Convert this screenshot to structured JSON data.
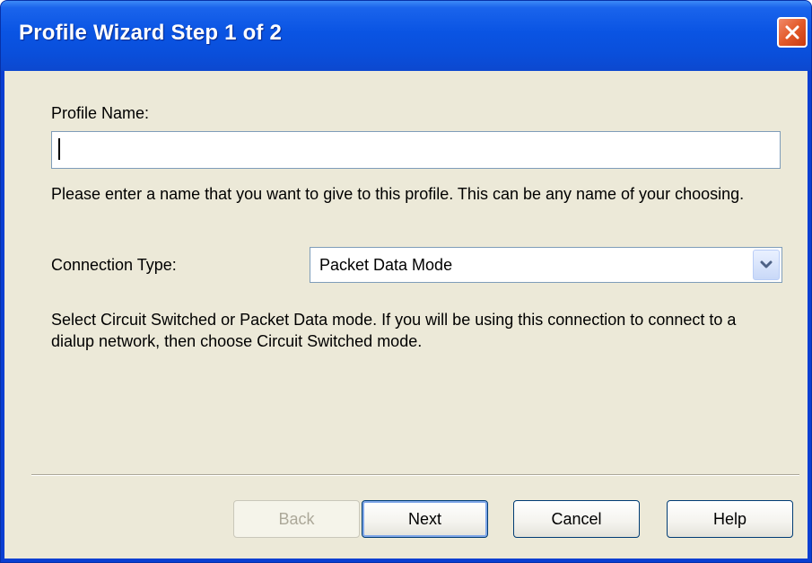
{
  "window": {
    "title": "Profile Wizard Step 1 of 2"
  },
  "form": {
    "profile_name_label": "Profile Name:",
    "profile_name_value": "",
    "profile_name_help": "Please enter a name that you want to give to this profile. This can be any name of your choosing.",
    "connection_type_label": "Connection Type:",
    "connection_type_value": "Packet Data Mode",
    "connection_type_help": "Select Circuit Switched or Packet Data mode.  If you will be using this connection to connect to a dialup network, then choose Circuit Switched mode."
  },
  "buttons": {
    "back": "Back",
    "next": "Next",
    "cancel": "Cancel",
    "help": "Help"
  },
  "icons": {
    "close": "close-icon",
    "dropdown": "chevron-down-icon"
  },
  "colors": {
    "titlebar": "#0a54e3",
    "client": "#ece9d8",
    "close_button": "#e35a2a"
  }
}
